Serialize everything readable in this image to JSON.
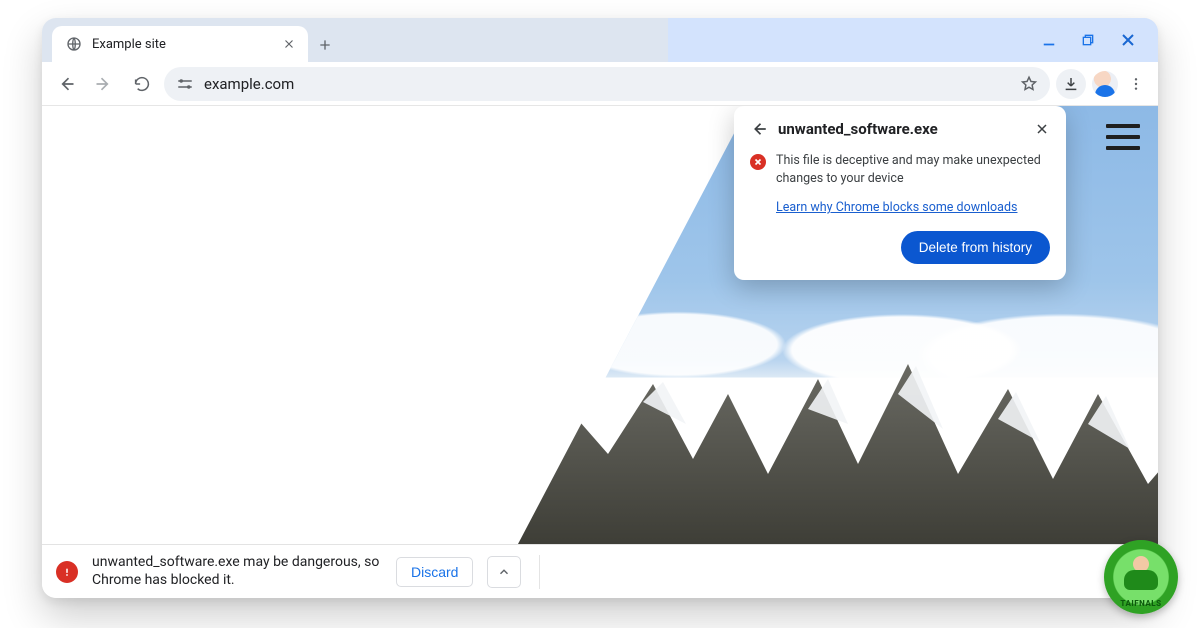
{
  "tab": {
    "title": "Example site"
  },
  "toolbar": {
    "url": "example.com"
  },
  "popover": {
    "filename": "unwanted_software.exe",
    "warning_text": "This file is deceptive and may make unexpected changes to your device",
    "learn_link": "Learn why Chrome blocks some downloads",
    "primary_action": "Delete from history"
  },
  "shelf": {
    "message": "unwanted_software.exe may be dangerous, so Chrome has blocked it.",
    "discard_label": "Discard"
  },
  "badge": {
    "label": "TAIFNALS"
  }
}
